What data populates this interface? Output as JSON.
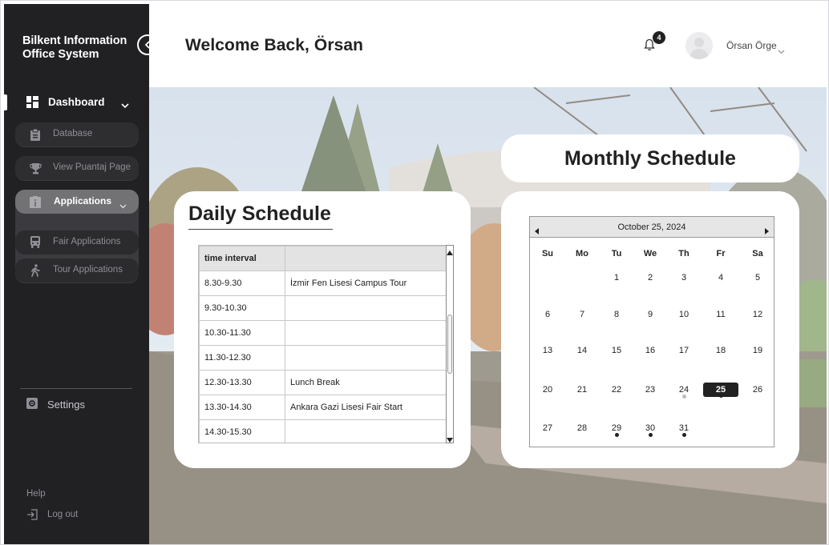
{
  "app": {
    "brand": "Bilkent Information Office System"
  },
  "sidebar": {
    "dashboard_label": "Dashboard",
    "items": [
      {
        "label": "Database",
        "icon": "clipboard-icon"
      },
      {
        "label": "View Puantaj Page",
        "icon": "trophy-icon"
      }
    ],
    "applications": {
      "label": "Applications",
      "icon": "info-icon",
      "children": [
        {
          "label": "Fair Applications",
          "icon": "bus-icon"
        },
        {
          "label": "Tour Applications",
          "icon": "walking-icon"
        }
      ]
    },
    "settings_label": "Settings",
    "help_label": "Help",
    "logout_label": "Log out"
  },
  "header": {
    "welcome": "Welcome Back, Örsan",
    "notification_count": "4",
    "user_name": "Örsan Örge"
  },
  "daily": {
    "title": "Daily Schedule",
    "columns": [
      "time interval",
      ""
    ],
    "rows": [
      {
        "time": "8.30-9.30",
        "event": "İzmir Fen Lisesi Campus Tour"
      },
      {
        "time": "9.30-10.30",
        "event": ""
      },
      {
        "time": "10.30-11.30",
        "event": ""
      },
      {
        "time": "11.30-12.30",
        "event": ""
      },
      {
        "time": "12.30-13.30",
        "event": "Lunch Break"
      },
      {
        "time": "13.30-14.30",
        "event": "Ankara Gazi Lisesi Fair Start"
      },
      {
        "time": "14.30-15.30",
        "event": ""
      }
    ]
  },
  "monthly": {
    "title": "Monthly Schedule",
    "calendar_title": "October 25, 2024",
    "weekdays": [
      "Su",
      "Mo",
      "Tu",
      "We",
      "Th",
      "Fr",
      "Sa"
    ],
    "first_weekday_index": 2,
    "days_in_month": 31,
    "selected_day": 25,
    "event_days": [
      25,
      29,
      30,
      31
    ],
    "light_event_days": [
      24
    ]
  },
  "colors": {
    "sidebar_bg": "#212124",
    "accent_dark": "#222222",
    "apps_active": "#727275"
  }
}
